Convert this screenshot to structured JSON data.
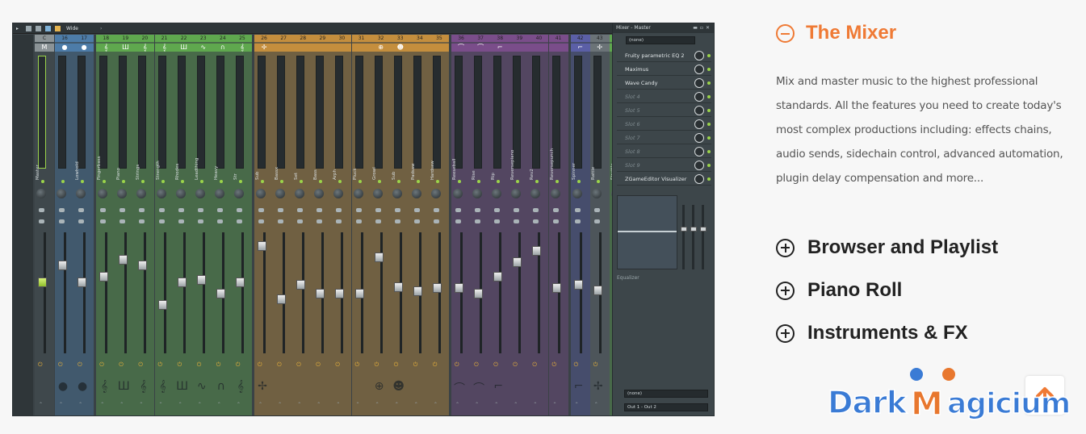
{
  "mixer": {
    "toolbar": {
      "mode_label": "Wide"
    },
    "master": {
      "header": "C",
      "icon": "M",
      "name": "Master",
      "fader": 0.6
    },
    "strips": [
      {
        "num": "16",
        "name": "",
        "icon": "●",
        "group": "blue",
        "fader": 0.75
      },
      {
        "num": "17",
        "name": "Lowhold",
        "icon": "●",
        "group": "blue",
        "fader": 0.6
      },
      {
        "num": "18",
        "name": "Fingerbass",
        "icon": "𝄞",
        "group": "green",
        "fader": 0.65
      },
      {
        "num": "19",
        "name": "Piano",
        "icon": "Ш",
        "group": "green",
        "fader": 0.8
      },
      {
        "num": "20",
        "name": "Strings",
        "icon": "𝄞",
        "group": "green",
        "fader": 0.75
      },
      {
        "num": "21",
        "name": "Strength",
        "icon": "𝄞",
        "group": "green",
        "fader": 0.4
      },
      {
        "num": "22",
        "name": "Rhodes",
        "icon": "Ш",
        "group": "green",
        "fader": 0.6
      },
      {
        "num": "23",
        "name": "Leadthing",
        "icon": "∿",
        "group": "green",
        "fader": 0.62
      },
      {
        "num": "24",
        "name": "Heavy",
        "icon": "∩",
        "group": "green",
        "fader": 0.5
      },
      {
        "num": "25",
        "name": "Str",
        "icon": "𝄞",
        "group": "green",
        "fader": 0.6
      },
      {
        "num": "26",
        "name": "Sub",
        "icon": "✢",
        "group": "orange",
        "fader": 0.92
      },
      {
        "num": "27",
        "name": "Bassx",
        "icon": "",
        "group": "orange",
        "fader": 0.45
      },
      {
        "num": "28",
        "name": "Set",
        "icon": "",
        "group": "orange",
        "fader": 0.58
      },
      {
        "num": "29",
        "name": "Bass",
        "icon": "",
        "group": "orange",
        "fader": 0.5
      },
      {
        "num": "30",
        "name": "Arph",
        "icon": "",
        "group": "orange",
        "fader": 0.5
      },
      {
        "num": "31",
        "name": "Pluck",
        "icon": "",
        "group": "orange",
        "fader": 0.5
      },
      {
        "num": "32",
        "name": "Growl",
        "icon": "⊕",
        "group": "orange",
        "fader": 0.82
      },
      {
        "num": "33",
        "name": "Sub",
        "icon": "☻",
        "group": "orange",
        "fader": 0.56
      },
      {
        "num": "34",
        "name": "Padsaw",
        "icon": "",
        "group": "orange",
        "fader": 0.52
      },
      {
        "num": "35",
        "name": "Hardsaw",
        "icon": "",
        "group": "orange",
        "fader": 0.55
      },
      {
        "num": "36",
        "name": "Reeseball",
        "icon": "⌒",
        "group": "purple",
        "fader": 0.55
      },
      {
        "num": "37",
        "name": "Rise",
        "icon": "⌒",
        "group": "purple",
        "fader": 0.5
      },
      {
        "num": "38",
        "name": "Rip",
        "icon": "⌐",
        "group": "purple",
        "fader": 0.65
      },
      {
        "num": "39",
        "name": "Reversepiano",
        "icon": "",
        "group": "purple",
        "fader": 0.78
      },
      {
        "num": "40",
        "name": "Rev2",
        "icon": "",
        "group": "purple",
        "fader": 0.88
      },
      {
        "num": "41",
        "name": "Reversepunch",
        "icon": "",
        "group": "purple",
        "fader": 0.55
      },
      {
        "num": "42",
        "name": "Spinner",
        "icon": "⌐",
        "group": "indigo",
        "fader": 0.58
      },
      {
        "num": "43",
        "name": "Rattle",
        "icon": "✢",
        "group": "gray",
        "fader": 0.53
      },
      {
        "num": "44",
        "name": "Strattle",
        "icon": "",
        "group": "green",
        "fader": 0.58
      }
    ],
    "colors": {
      "blue": "#4d7ca8",
      "green": "#5fa84e",
      "orange": "#c48e3d",
      "purple": "#7a4d8a",
      "indigo": "#5b5fa6",
      "gray": "#6b7377"
    },
    "panel": {
      "title": "Mixer - Master",
      "input": "(none)",
      "slots": [
        {
          "label": "Fruity parametric EQ 2",
          "empty": false
        },
        {
          "label": "Maximus",
          "empty": false
        },
        {
          "label": "Wave Candy",
          "empty": false
        },
        {
          "label": "Slot 4",
          "empty": true
        },
        {
          "label": "Slot 5",
          "empty": true
        },
        {
          "label": "Slot 6",
          "empty": true
        },
        {
          "label": "Slot 7",
          "empty": true
        },
        {
          "label": "Slot 8",
          "empty": true
        },
        {
          "label": "Slot 9",
          "empty": true
        },
        {
          "label": "ZGameEditor Visualizer",
          "empty": false
        }
      ],
      "eq_label": "Equalizer",
      "output_none": "(none)",
      "output_route": "Out 1 - Out 2"
    }
  },
  "accordion": {
    "active": {
      "title": "The Mixer",
      "description": "Mix and master music to the highest professional standards. All the features you need to create today's most complex productions including: effects chains, audio sends, sidechain control, advanced automation, plugin delay compensation and more..."
    },
    "items": [
      "Browser and Playlist",
      "Piano Roll",
      "Instruments & FX"
    ]
  },
  "watermark": {
    "text": "DarkMagicium"
  }
}
